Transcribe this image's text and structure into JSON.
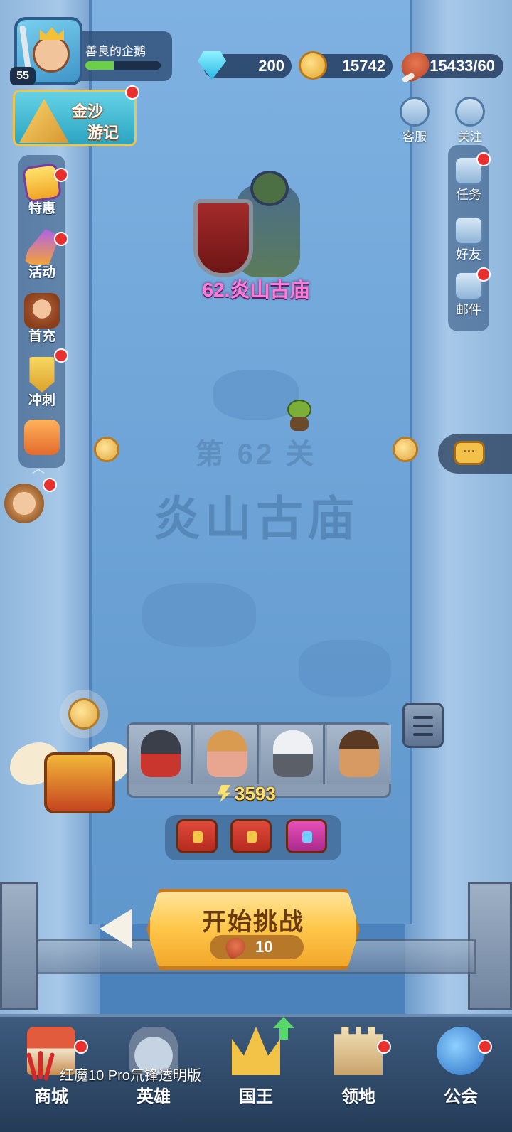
{
  "player": {
    "name": "善良的企鹅",
    "level": "55",
    "xp_fraction": 0.38
  },
  "resources": {
    "gems": "200",
    "gold": "15742",
    "stamina": "15433/60"
  },
  "top_buttons": {
    "service": "客服",
    "follow": "关注"
  },
  "event_banner": {
    "line1": "金沙",
    "line2": "游记"
  },
  "left_menu": [
    {
      "label": "特惠",
      "icon": "special-offer-icon"
    },
    {
      "label": "活动",
      "icon": "activity-icon"
    },
    {
      "label": "首充",
      "icon": "first-recharge-icon"
    },
    {
      "label": "冲刺",
      "icon": "sprint-trophy-icon"
    }
  ],
  "right_menu": [
    {
      "label": "任务",
      "icon": "task-icon"
    },
    {
      "label": "好友",
      "icon": "friends-icon"
    },
    {
      "label": "邮件",
      "icon": "mail-icon"
    }
  ],
  "stage": {
    "boss_label": "62.炎山古庙",
    "number_text": "第 62 关",
    "name_text": "炎山古庙"
  },
  "team": {
    "power": "3593"
  },
  "start": {
    "label": "开始挑战",
    "cost": "10"
  },
  "bottom_nav": [
    {
      "label": "商城",
      "icon": "shop-icon"
    },
    {
      "label": "英雄",
      "icon": "hero-helmet-icon"
    },
    {
      "label": "国王",
      "icon": "king-crown-icon"
    },
    {
      "label": "领地",
      "icon": "territory-castle-icon"
    },
    {
      "label": "公会",
      "icon": "guild-planet-icon"
    }
  ],
  "device_watermark": "红魔10 Pro氘锋透明版",
  "colors": {
    "notification_dot": "#e9302f",
    "gold_text": "#ffe16e",
    "boss_label": "#ff7cd6"
  }
}
